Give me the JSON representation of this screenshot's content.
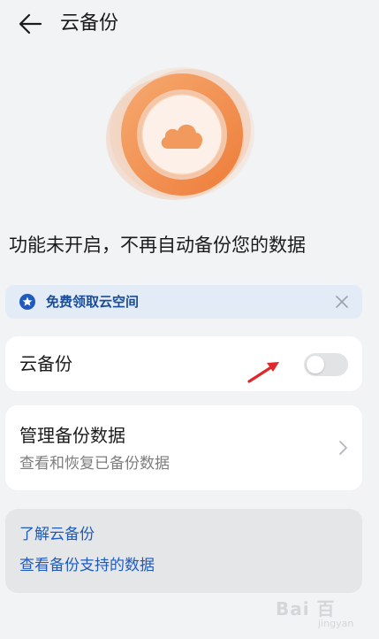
{
  "header": {
    "title": "云备份"
  },
  "status": {
    "text": "功能未开启，不再自动备份您的数据"
  },
  "promo": {
    "text": "免费领取云空间"
  },
  "backup_toggle": {
    "label": "云备份",
    "enabled": false
  },
  "manage": {
    "title": "管理备份数据",
    "subtitle": "查看和恢复已备份数据"
  },
  "links": {
    "learn": "了解云备份",
    "supported": "查看备份支持的数据"
  },
  "watermark": {
    "brand": "Bai 百",
    "sub": "jingyan"
  },
  "colors": {
    "accent_blue": "#1f5bbf",
    "promo_bg": "#e3ebf6",
    "hero_orange": "#f08a46",
    "annotation_red": "#e0282a"
  }
}
